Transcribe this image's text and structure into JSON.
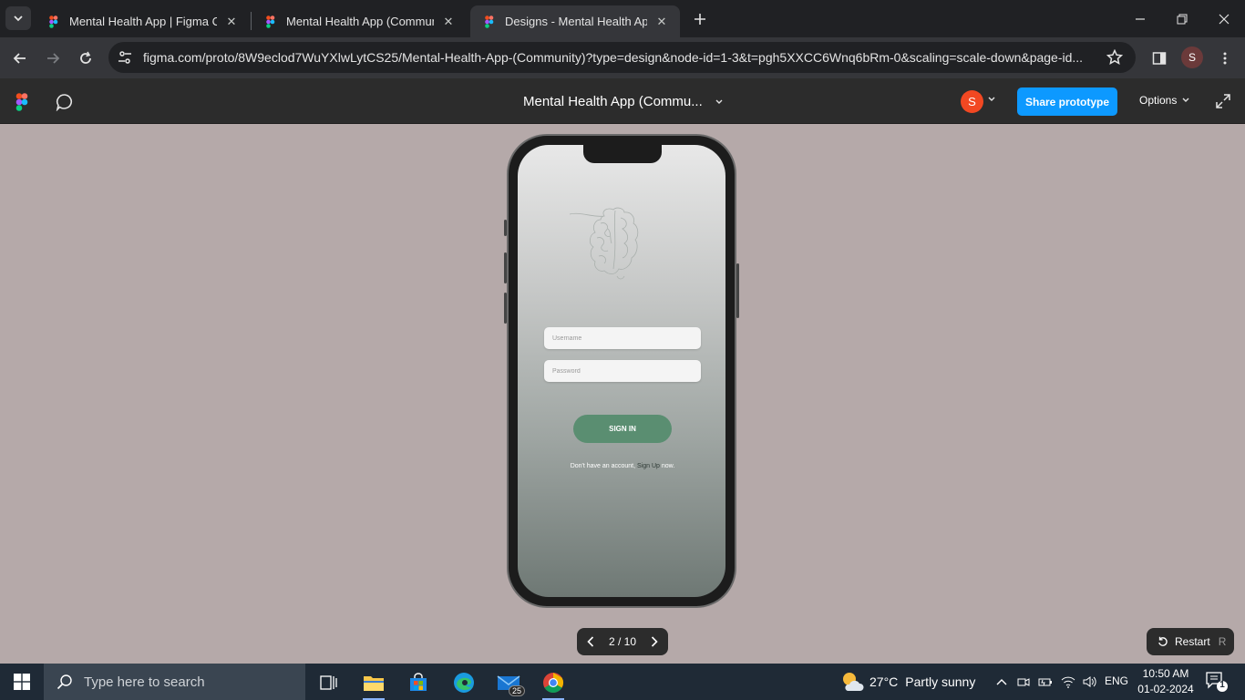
{
  "browser": {
    "tabs": [
      {
        "title": "Mental Health App | Figma Com",
        "active": false
      },
      {
        "title": "Mental Health App (Community",
        "active": false
      },
      {
        "title": "Designs - Mental Health App (C",
        "active": true
      }
    ],
    "address_url": "figma.com/proto/8W9eclod7WuYXlwLytCS25/Mental-Health-App-(Community)?type=design&node-id=1-3&t=pgh5XXCC6Wnq6bRm-0&scaling=scale-down&page-id...",
    "profile_initial": "S"
  },
  "figma": {
    "file_title": "Mental Health App (Commu...",
    "avatar_initial": "S",
    "share_label": "Share prototype",
    "options_label": "Options",
    "accent_color": "#0d99ff"
  },
  "app_screen": {
    "username_placeholder": "Username",
    "password_placeholder": "Password",
    "signin_label": "SIGN IN",
    "signup_prefix": "Don't have an account,",
    "signup_link": "Sign Up",
    "signup_suffix": "now.",
    "button_color": "#5a8e71"
  },
  "prototype_controls": {
    "page_indicator": "2 / 10",
    "restart_label": "Restart",
    "restart_shortcut": "R"
  },
  "taskbar": {
    "search_placeholder": "Type here to search",
    "mail_badge": "25",
    "weather_temp": "27°C",
    "weather_desc": "Partly sunny",
    "language": "ENG",
    "time": "10:50 AM",
    "date": "01-02-2024",
    "notification_count": "1"
  }
}
